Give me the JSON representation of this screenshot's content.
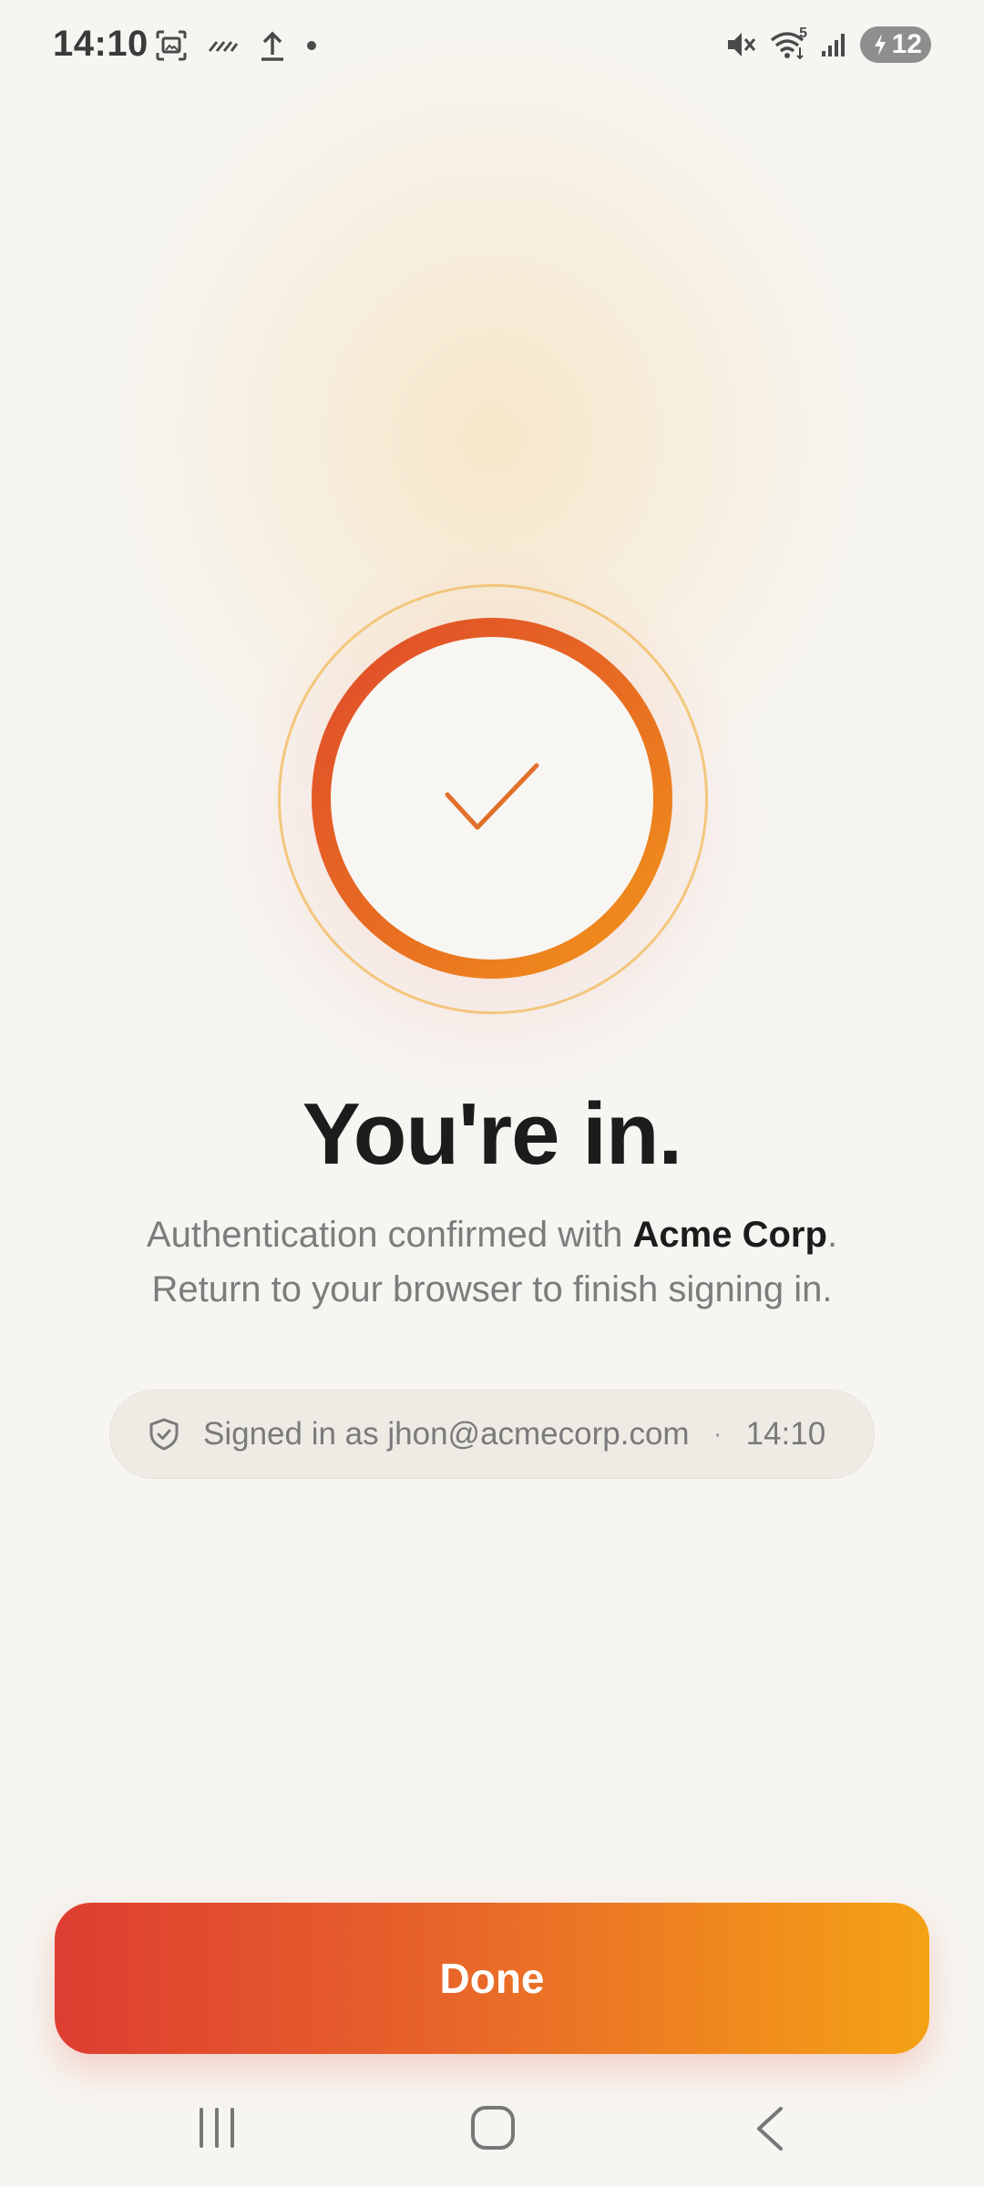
{
  "status_bar": {
    "time": "14:10",
    "left_icons": [
      "screenshot-icon",
      "nfc-icon",
      "upload-icon",
      "dot-icon"
    ],
    "right_icons": [
      "mute-icon",
      "wifi-icon",
      "signal-icon",
      "battery-icon"
    ],
    "wifi_badge": "5",
    "battery_level": "12"
  },
  "main": {
    "icon": "check-icon",
    "title": "You're in.",
    "subtitle_prefix": "Authentication confirmed with ",
    "org_name": "Acme Corp",
    "subtitle_suffix": ".",
    "subtitle_line2": "Return to your browser to finish signing in."
  },
  "signed_in": {
    "icon": "shield-check-icon",
    "label": "Signed in as jhon@acmecorp.com",
    "separator": "·",
    "time": "14:10"
  },
  "actions": {
    "done_label": "Done"
  },
  "nav_bar": {
    "buttons": [
      "recents-icon",
      "home-icon",
      "back-icon"
    ]
  },
  "colors": {
    "accent_start": "#de3d31",
    "accent_end": "#f5a215",
    "background": "#f7f5f1",
    "ring_outer": "#f4c67c"
  }
}
